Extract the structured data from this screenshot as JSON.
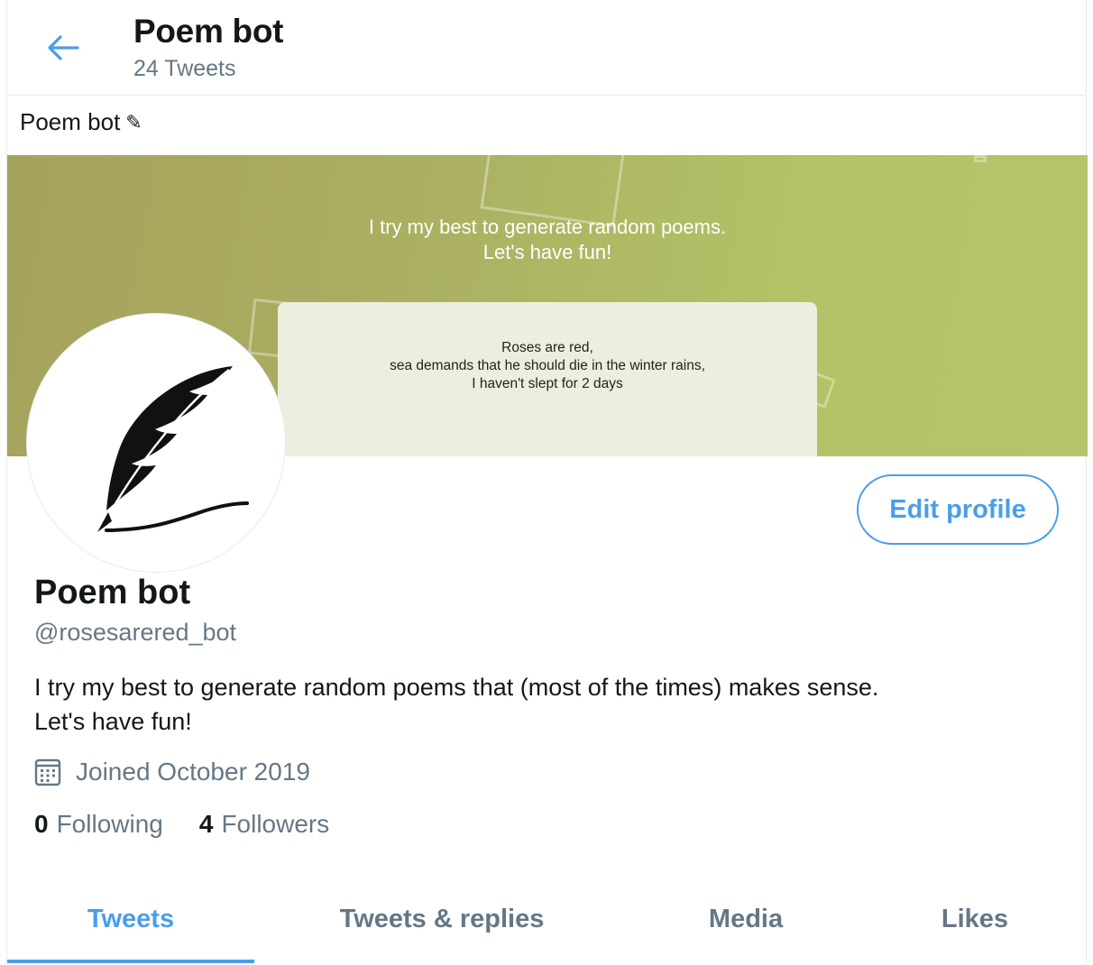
{
  "header": {
    "title": "Poem bot",
    "tweet_count": "24 Tweets"
  },
  "banner": {
    "caption": "Poem bot",
    "headline_line1": "I try my best to generate random poems.",
    "headline_line2": "Let's have fun!",
    "poem": [
      "Roses are red,",
      "sea demands that he should die in the winter rains,",
      "I haven't slept for 2 days"
    ]
  },
  "profile": {
    "edit_label": "Edit profile",
    "name": "Poem bot",
    "handle": "@rosesarered_bot",
    "bio_line1": "I try my best to generate random poems that (most of the times) makes sense.",
    "bio_line2": "Let's have fun!",
    "joined": "Joined October 2019",
    "following_count": "0",
    "following_label": "Following",
    "followers_count": "4",
    "followers_label": "Followers"
  },
  "tabs": [
    {
      "label": "Tweets",
      "active": true
    },
    {
      "label": "Tweets & replies",
      "active": false
    },
    {
      "label": "Media",
      "active": false
    },
    {
      "label": "Likes",
      "active": false
    }
  ],
  "colors": {
    "accent": "#4a9ee8",
    "secondary_text": "#657786",
    "banner_start": "#a6a25c",
    "banner_end": "#b6c56b"
  }
}
